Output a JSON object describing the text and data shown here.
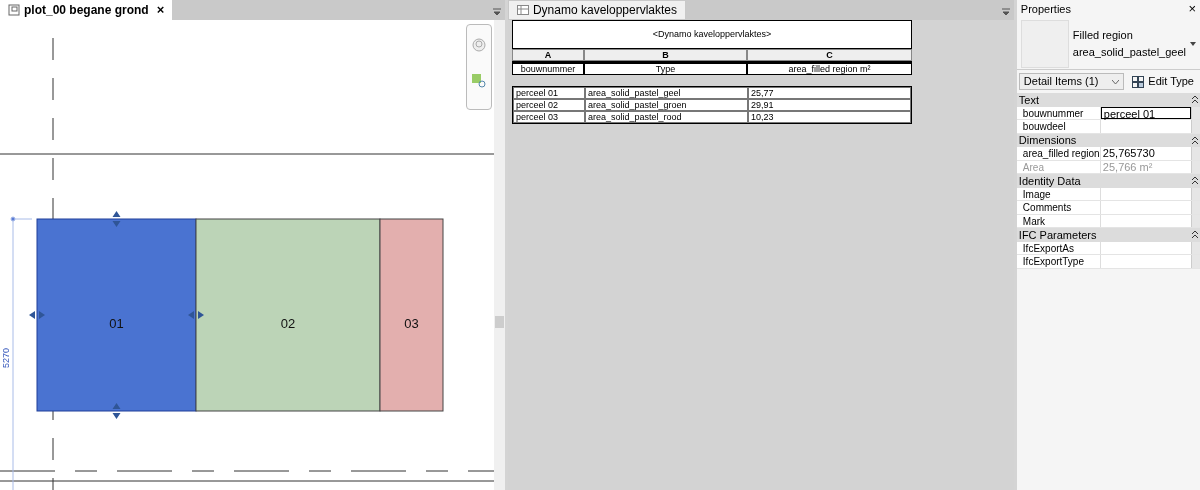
{
  "plan_view": {
    "tab": {
      "title": "plot_00 begane grond",
      "close": "×",
      "selected": true
    },
    "regions": [
      {
        "label": "01",
        "color": "#4a73d1",
        "selected": true
      },
      {
        "label": "02",
        "color": "#bcd4b7",
        "selected": false
      },
      {
        "label": "03",
        "color": "#e3afae",
        "selected": false
      }
    ],
    "dimension": "5270"
  },
  "schedule": {
    "tab": {
      "title": "Dynamo kaveloppervlaktes",
      "selected": false
    },
    "title": "<Dynamo kaveloppervlaktes>",
    "column_letters": [
      "A",
      "B",
      "C"
    ],
    "columns": [
      "bouwnummer",
      "Type",
      "area_filled region m²"
    ],
    "rows": [
      [
        "perceel 01",
        "area_solid_pastel_geel",
        "25,77"
      ],
      [
        "perceel 02",
        "area_solid_pastel_groen",
        "29,91"
      ],
      [
        "perceel 03",
        "area_solid_pastel_rood",
        "10,23"
      ]
    ]
  },
  "properties": {
    "title": "Properties",
    "close": "×",
    "family": "Filled region",
    "type": "area_solid_pastel_geel",
    "filter": "Detail Items (1)",
    "edit_type": "Edit Type",
    "groups": [
      {
        "name": "Text",
        "rows": [
          {
            "label": "bouwnummer",
            "value": "perceel 01",
            "focused": true,
            "disabled": false
          },
          {
            "label": "bouwdeel",
            "value": "",
            "focused": false,
            "disabled": false
          }
        ]
      },
      {
        "name": "Dimensions",
        "rows": [
          {
            "label": "area_filled region",
            "value": "25,765730",
            "focused": false,
            "disabled": false
          },
          {
            "label": "Area",
            "value": "25,766 m²",
            "focused": false,
            "disabled": true
          }
        ]
      },
      {
        "name": "Identity Data",
        "rows": [
          {
            "label": "Image",
            "value": "",
            "focused": false,
            "disabled": false
          },
          {
            "label": "Comments",
            "value": "",
            "focused": false,
            "disabled": false
          },
          {
            "label": "Mark",
            "value": "",
            "focused": false,
            "disabled": false
          }
        ]
      },
      {
        "name": "IFC Parameters",
        "rows": [
          {
            "label": "IfcExportAs",
            "value": "",
            "focused": false,
            "disabled": false
          },
          {
            "label": "IfcExportType",
            "value": "",
            "focused": false,
            "disabled": false
          }
        ]
      }
    ]
  }
}
